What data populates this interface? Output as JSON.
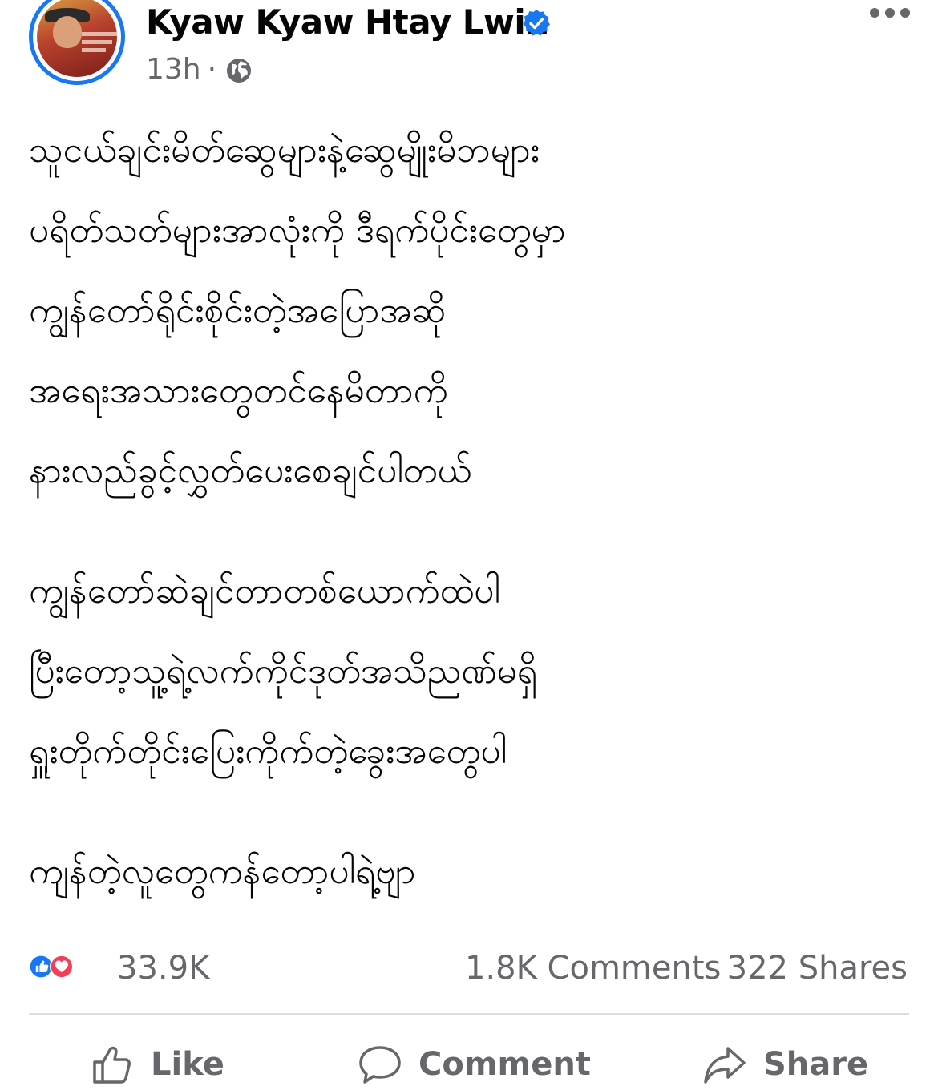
{
  "post": {
    "author": "Kyaw Kyaw Htay Lwin",
    "time": "13h",
    "separator": "·",
    "privacy_icon": "globe-icon",
    "verified_icon": "verified-badge-icon",
    "paragraphs": [
      [
        "သူငယ်ချင်းမိတ်ဆွေများနဲ့ဆွေမျိုးမိဘများ",
        "ပရိတ်သတ်များအာလုံးကို ဒီရက်ပိုင်းတွေမှာ",
        "ကျွန်တော်ရိုင်းစိုင်းတဲ့အပြောအဆို",
        "အရေးအသားတွေတင်နေမိတာကို",
        "နားလည်ခွင့်လွှတ်ပေးစေချင်ပါတယ်"
      ],
      [
        "ကျွန်တော်ဆဲချင်တာတစ်ယောက်ထဲပါ",
        "ပြီးတော့သူ့ရဲ့လက်ကိုင်ဒုတ်အသိညဏ်မရှိ",
        "ရှူးတိုက်တိုင်းပြေးကိုက်တဲ့ခွေးအတွေပါ"
      ],
      [
        "ကျန်တဲ့လူတွေကန်တော့ပါရဲ့ဗျာ"
      ]
    ]
  },
  "stats": {
    "reactions_count": "33.9K",
    "comments": "1.8K Comments",
    "shares": "322 Shares",
    "reaction_icons": [
      "like-reaction-icon",
      "love-reaction-icon"
    ]
  },
  "actions": {
    "like": "Like",
    "comment": "Comment",
    "share": "Share"
  },
  "colors": {
    "accent": "#1877f2",
    "love": "#f33e58",
    "secondary_text": "#65676b",
    "text": "#050505",
    "divider": "#dadde1"
  }
}
